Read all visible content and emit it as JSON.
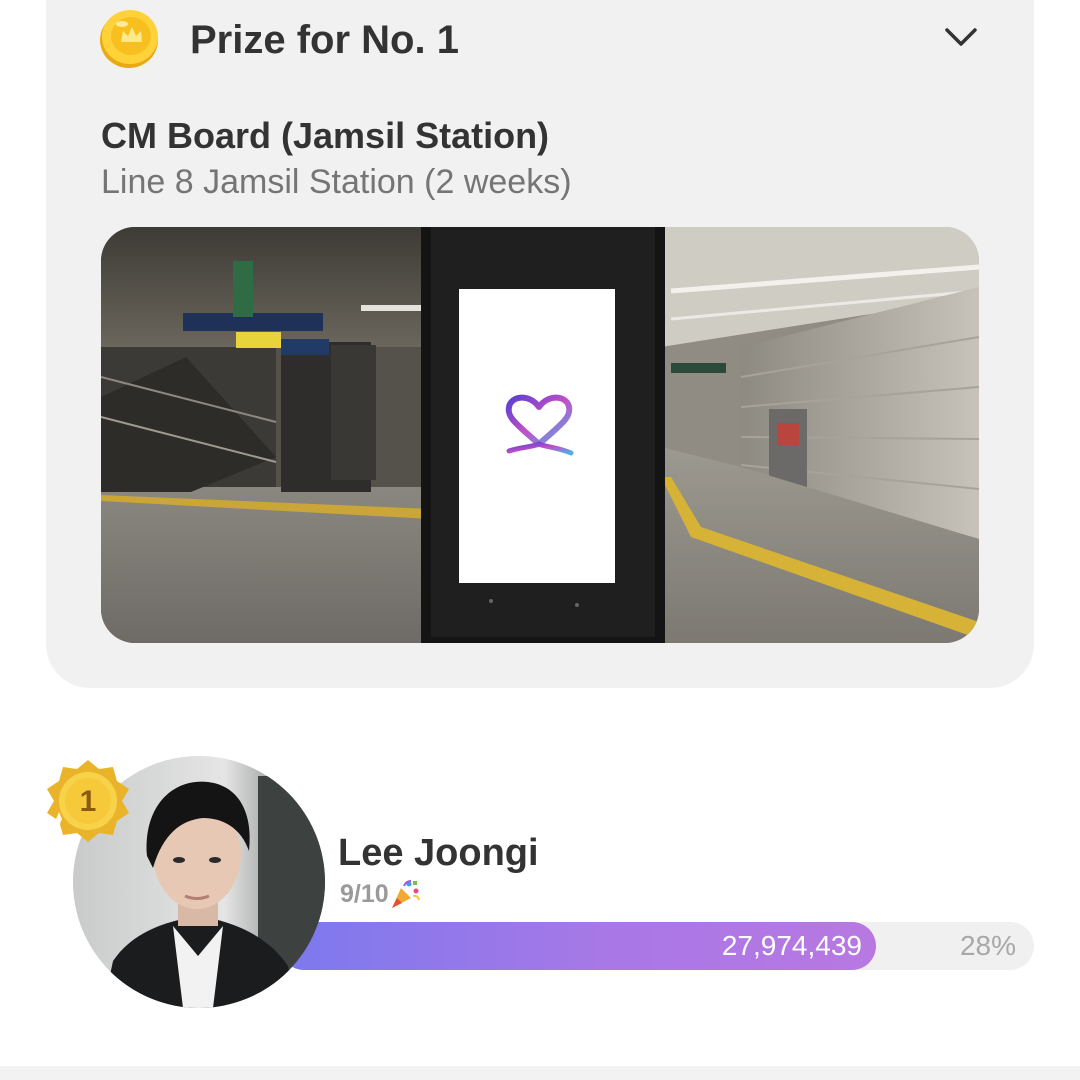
{
  "prize": {
    "title": "Prize for No. 1",
    "item_title": "CM Board (Jamsil Station)",
    "item_subtitle": "Line 8 Jamsil Station (2 weeks)",
    "icons": {
      "coin": "coin-icon",
      "expand": "chevron-down-icon"
    }
  },
  "ranking": {
    "rank": "1",
    "name": "Lee Joongi",
    "date": "9/10",
    "date_icon": "party-popper-icon",
    "votes": "27,974,439",
    "percent": "28%",
    "fill_fraction": 0.79
  },
  "colors": {
    "card_bg": "#f1f1f1",
    "text_dark": "#333333",
    "text_muted": "#757575",
    "bar_start": "#7b79ee",
    "bar_end": "#b878e2",
    "medal_gold": "#f2c230"
  }
}
